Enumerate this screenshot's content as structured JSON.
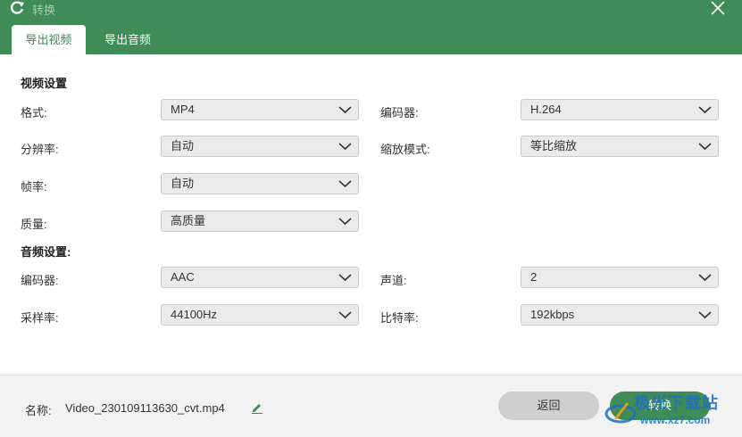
{
  "window": {
    "title": "转换",
    "icons": {
      "app": "refresh-icon",
      "close": "close-icon"
    },
    "colors": {
      "accent": "#3f8c56",
      "content_bg": "#ffffff",
      "select_bg": "#eaeaea",
      "back_button": "#cfcfcf"
    }
  },
  "tabs": [
    {
      "label": "导出视频",
      "active": true
    },
    {
      "label": "导出音频",
      "active": false
    }
  ],
  "video_settings": {
    "section_title": "视频设置",
    "format": {
      "label": "格式:",
      "value": "MP4"
    },
    "encoder": {
      "label": "编码器:",
      "value": "H.264"
    },
    "resolution": {
      "label": "分辨率:",
      "value": "自动"
    },
    "scale_mode": {
      "label": "缩放模式:",
      "value": "等比缩放"
    },
    "frame_rate": {
      "label": "帧率:",
      "value": "自动"
    },
    "quality": {
      "label": "质量:",
      "value": "高质量"
    }
  },
  "audio_settings": {
    "section_title": "音频设置:",
    "encoder": {
      "label": "编码器:",
      "value": "AAC"
    },
    "channels": {
      "label": "声道:",
      "value": "2"
    },
    "sample_rate": {
      "label": "采样率:",
      "value": "44100Hz"
    },
    "bitrate": {
      "label": "比特率:",
      "value": "192kbps"
    }
  },
  "footer": {
    "name_label": "名称:",
    "filename": "Video_230109113630_cvt.mp4",
    "back_label": "返回",
    "convert_label": "转换"
  },
  "watermark": {
    "text": "极光下载站",
    "url": "www.xz7.com"
  }
}
